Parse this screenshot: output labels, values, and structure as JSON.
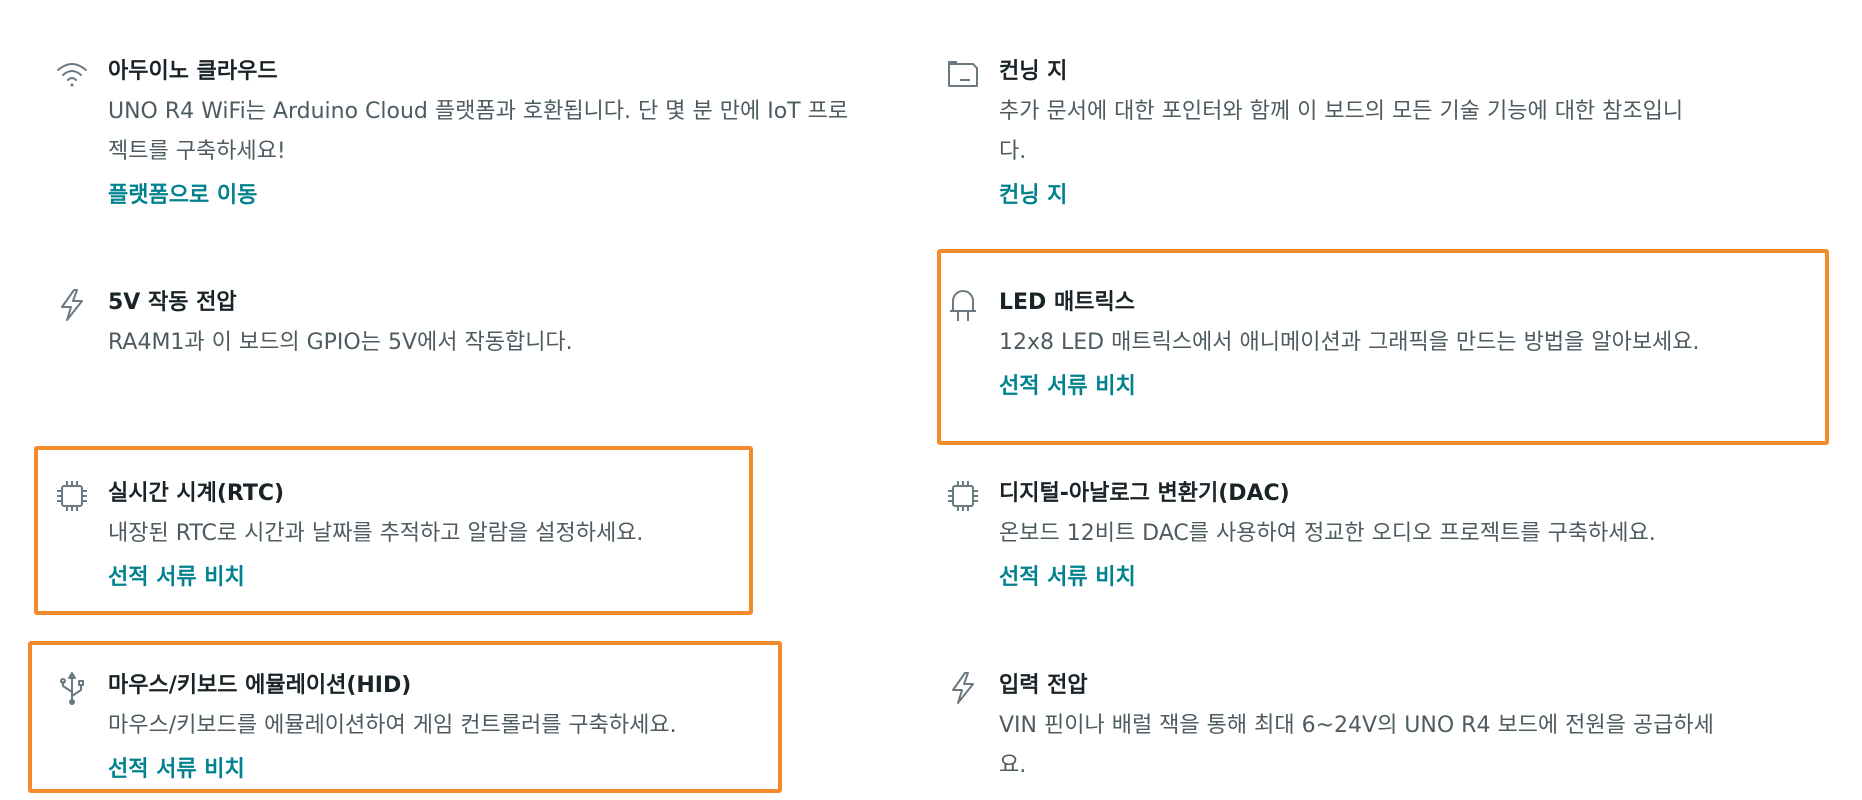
{
  "features": {
    "cloud": {
      "title": "아두이노 클라우드",
      "desc_line1": "UNO R4 WiFi는 Arduino Cloud 플랫폼과 호환됩니다. 단 몇 분 만에 IoT 프로",
      "desc_line2": "젝트를 구축하세요!",
      "link": "플랫폼으로 이동",
      "icon": "wifi-icon"
    },
    "cheatsheet": {
      "title": "컨닝 지",
      "desc_line1": "추가 문서에 대한 포인터와 함께 이 보드의 모든 기술 기능에 대한 참조입니",
      "desc_line2": "다.",
      "link": "컨닝 지",
      "icon": "cheat-sheet-icon"
    },
    "voltage5v": {
      "title": "5V 작동 전압",
      "desc_line1": "RA4M1과 이 보드의 GPIO는 5V에서 작동합니다.",
      "icon": "lightning-icon"
    },
    "led_matrix": {
      "title": "LED 매트릭스",
      "desc_line1": "12x8 LED 매트릭스에서 애니메이션과 그래픽을 만드는 방법을 알아보세요.",
      "link": "선적 서류 비치",
      "icon": "led-icon"
    },
    "rtc": {
      "title": "실시간 시계(RTC)",
      "desc_line1": "내장된 RTC로 시간과 날짜를 추적하고 알람을 설정하세요.",
      "link": "선적 서류 비치",
      "icon": "chip-icon"
    },
    "dac": {
      "title": "디지털-아날로그 변환기(DAC)",
      "desc_line1": "온보드 12비트 DAC를 사용하여 정교한 오디오 프로젝트를 구축하세요.",
      "link": "선적 서류 비치",
      "icon": "chip-icon"
    },
    "hid": {
      "title": "마우스/키보드 에뮬레이션(HID)",
      "desc_line1": "마우스/키보드를 에뮬레이션하여 게임 컨트롤러를 구축하세요.",
      "link": "선적 서류 비치",
      "icon": "usb-icon"
    },
    "input_voltage": {
      "title": "입력 전압",
      "desc_line1": "VIN 핀이나 배럴 잭을 통해 최대 6~24V의 UNO R4 보드에 전원을 공급하세",
      "desc_line2": "요.",
      "icon": "lightning-icon"
    }
  },
  "colors": {
    "title": "#1a2327",
    "text": "#4e5b61",
    "link": "#00838f",
    "highlight": "#f38b2c"
  }
}
